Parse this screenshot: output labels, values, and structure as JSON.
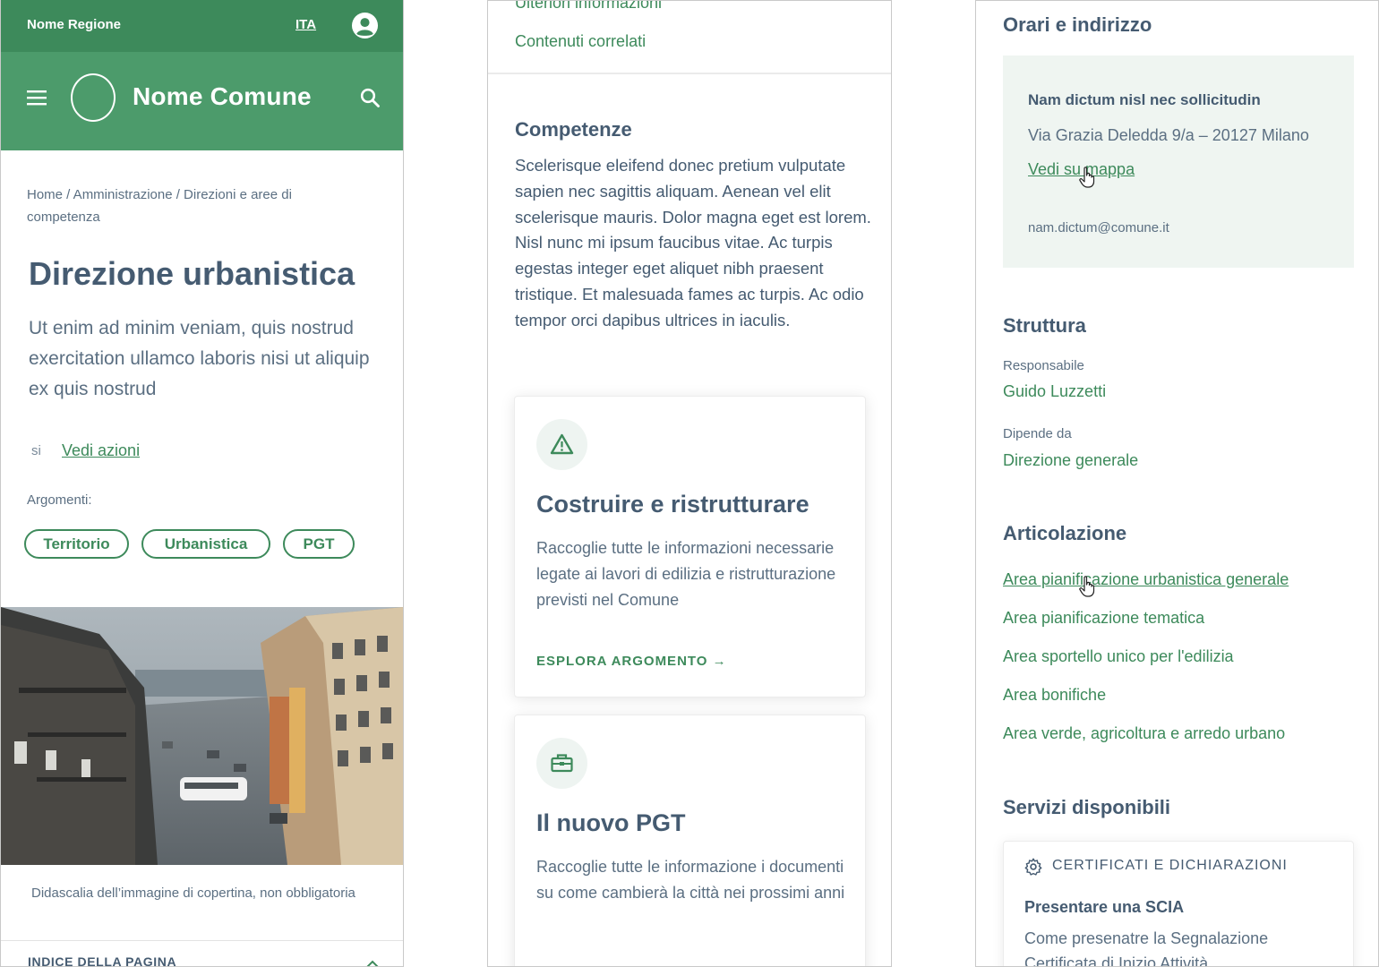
{
  "colors": {
    "primary": "#3d8a5b",
    "header": "#4c9b6b",
    "text": "#455b71",
    "box": "#eff5f1"
  },
  "panel1": {
    "region_name": "Nome Regione",
    "language": "ITA",
    "user_icon": "user-circle-icon",
    "menu_icon": "hamburger-icon",
    "search_icon": "search-icon",
    "municipality_name": "Nome Comune",
    "breadcrumb": "Home  /  Amministrazione  /  Direzioni e aree di competenza",
    "title": "Direzione urbanistica",
    "lead": "Ut enim ad minim veniam, quis nostrud exercitation ullamco laboris nisi ut aliquip ex quis nostrud",
    "actions_si": "si",
    "actions_link": "Vedi azioni",
    "topics_label": "Argomenti:",
    "topics": [
      "Territorio",
      "Urbanistica",
      "PGT"
    ],
    "cover_caption": "Didascalia dell’immagine di copertina, non obbligatoria",
    "page_index_label": "INDICE DELLA PAGINA"
  },
  "panel2": {
    "nav_links": [
      "Ulteriori informazioni",
      "Contenuti correlati"
    ],
    "competences_title": "Competenze",
    "competences_text": "Scelerisque eleifend donec pretium vulputate sapien nec sagittis aliquam. Aenean vel elit scelerisque mauris. Dolor magna eget est lorem. Nisl nunc mi ipsum faucibus vitae. Ac turpis egestas integer eget aliquet nibh praesent tristique. Et malesuada fames ac turpis. Ac odio tempor orci dapibus ultrices in iaculis.",
    "cards": [
      {
        "icon": "warning-triangle-icon",
        "title": "Costruire e ristrutturare",
        "text": "Raccoglie tutte le informazioni necessarie legate ai lavori di edilizia e ristrutturazione previsti nel Comune",
        "cta": "ESPLORA ARGOMENTO"
      },
      {
        "icon": "toolbox-icon",
        "title": "Il nuovo PGT",
        "text": "Raccoglie tutte le informazione i documenti su come cambierà la città nei prossimi anni"
      }
    ]
  },
  "panel3": {
    "hours_title": "Orari e indirizzo",
    "address": {
      "name": "Nam dictum nisl nec sollicitudin",
      "street": "Via Grazia Deledda 9/a – 20127 Milano",
      "map_link": "Vedi su mappa",
      "email": "nam.dictum@comune.it"
    },
    "structure_title": "Struttura",
    "manager_label": "Responsabile",
    "manager_name": "Guido Luzzetti",
    "depends_label": "Dipende da",
    "depends_value": "Direzione generale",
    "articulation_title": "Articolazione",
    "areas": [
      "Area pianificazione urbanistica generale",
      "Area pianificazione tematica",
      "Area sportello unico per l'edilizia",
      "Area bonifiche",
      "Area verde, agricoltura e arredo urbano"
    ],
    "services_title": "Servizi disponibili",
    "service": {
      "icon": "gear-icon",
      "category": "CERTIFICATI E DICHIARAZIONI",
      "title": "Presentare una SCIA",
      "text": "Come presenatre la Segnalazione Certificata di Inizio Attività"
    }
  }
}
